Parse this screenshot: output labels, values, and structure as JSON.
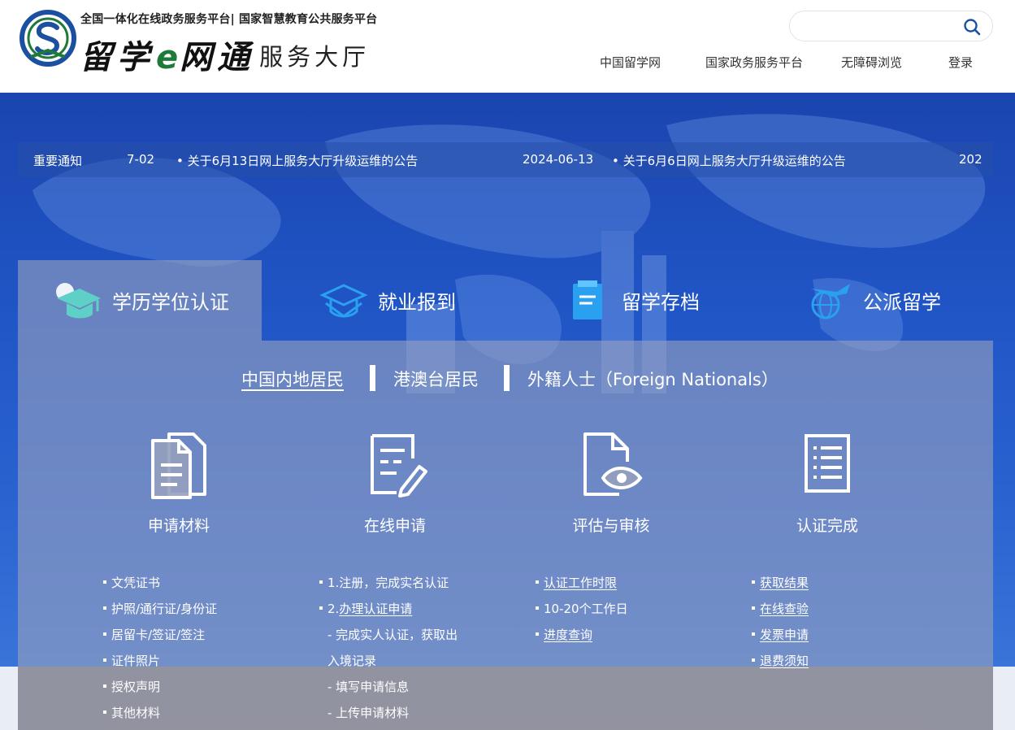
{
  "header": {
    "platform_line": "全国一体化在线政务服务平台| 国家智慧教育公共服务平台",
    "brand_main": "留学",
    "brand_e": "e",
    "brand_main2": "网通",
    "brand_sub": "服务大厅",
    "search_placeholder": "",
    "nav": [
      "中国留学网",
      "国家政务服务平台",
      "无障碍浏览",
      "登录"
    ]
  },
  "notice": {
    "label": "重要通知",
    "items": [
      {
        "date": "7-02",
        "title": ""
      },
      {
        "date": "",
        "title": "关于6月13日网上服务大厅升级运维的公告"
      },
      {
        "date": "2024-06-13",
        "title": ""
      },
      {
        "date": "",
        "title": "关于6月6日网上服务大厅升级运维的公告"
      },
      {
        "date": "202",
        "title": ""
      }
    ]
  },
  "service_tabs": [
    {
      "label": "学历学位认证",
      "active": true
    },
    {
      "label": "就业报到",
      "active": false
    },
    {
      "label": "留学存档",
      "active": false
    },
    {
      "label": "公派留学",
      "active": false
    }
  ],
  "sub_tabs": [
    {
      "label": "中国内地居民",
      "active": true
    },
    {
      "label": "港澳台居民",
      "active": false
    },
    {
      "label": "外籍人士（Foreign Nationals）",
      "active": false
    }
  ],
  "steps": [
    {
      "label": "申请材料",
      "icon": "documents-icon"
    },
    {
      "label": "在线申请",
      "icon": "form-edit-icon"
    },
    {
      "label": "评估与审核",
      "icon": "file-eye-icon"
    },
    {
      "label": "认证完成",
      "icon": "checklist-icon"
    }
  ],
  "lists": {
    "materials": [
      "文凭证书",
      "护照/通行证/身份证",
      "居留卡/签证/签注",
      "证件照片",
      "授权声明",
      "其他材料"
    ],
    "apply": [
      {
        "text": "1.注册，完成实名认证",
        "link": false,
        "dot": true
      },
      {
        "text": "2.办理认证申请",
        "link": true,
        "dot": true,
        "prefix": "2."
      },
      {
        "text": "- 完成实人认证，获取出",
        "link": false,
        "dot": false
      },
      {
        "text": "入境记录",
        "link": false,
        "dot": false
      },
      {
        "text": "- 填写申请信息",
        "link": false,
        "dot": false
      },
      {
        "text": "- 上传申请材料",
        "link": false,
        "dot": false
      }
    ],
    "review": [
      {
        "text": "认证工作时限",
        "link": true
      },
      {
        "text": "10-20个工作日",
        "link": false
      },
      {
        "text": "进度查询",
        "link": true
      }
    ],
    "done": [
      {
        "text": "获取结果",
        "link": true
      },
      {
        "text": "在线查验",
        "link": true
      },
      {
        "text": "发票申请",
        "link": true
      },
      {
        "text": "退费须知",
        "link": true
      }
    ]
  },
  "colors": {
    "hero_blue": "#2156c7",
    "brand_green": "#1f7a3a",
    "logo_blue": "#1b4fa0",
    "icon_teal": "#5fd0c8",
    "icon_blue": "#2aa0f0"
  }
}
